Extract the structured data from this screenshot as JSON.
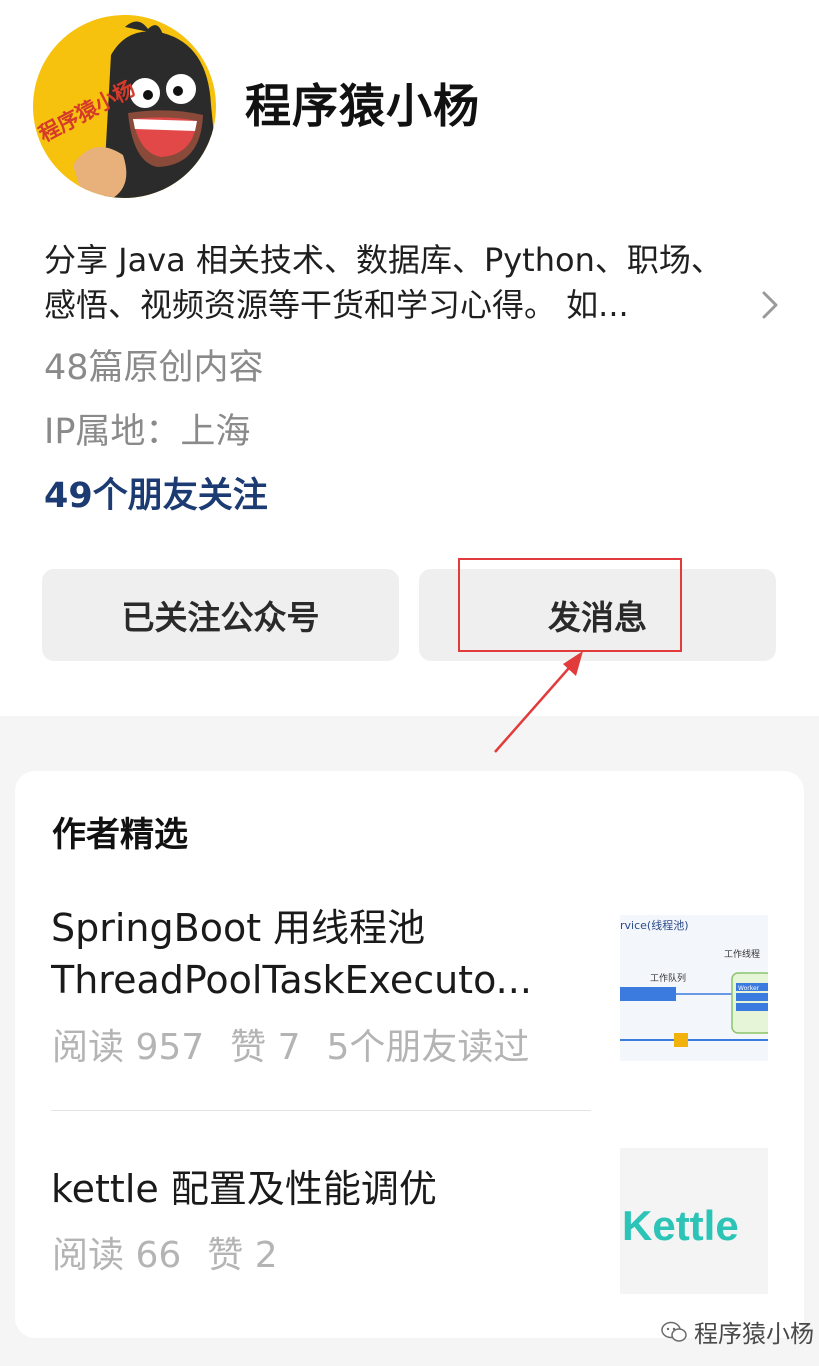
{
  "profile": {
    "name": "程序猿小杨",
    "avatar_text": "程序猿小杨",
    "description_lines": [
      "分享 Java 相关技术、数据库、Python、职场、",
      "感悟、视频资源等干货和学习心得。 如..."
    ],
    "articles_count": "48篇原创内容",
    "ip_location": "IP属地：上海",
    "friends_following": "49个朋友关注"
  },
  "actions": {
    "follow_label": "已关注公众号",
    "message_label": "发消息"
  },
  "featured": {
    "title": "作者精选",
    "articles": [
      {
        "title_lines": [
          "SpringBoot 用线程池",
          "ThreadPoolTaskExecuto..."
        ],
        "reads": "阅读 957",
        "likes": "赞 7",
        "friends_read": "5个朋友读过",
        "thumb_caption": "rvice(线程池)",
        "thumb_labels": [
          "工作线程",
          "工作队列",
          "Worker"
        ]
      },
      {
        "title_lines": [
          "kettle 配置及性能调优"
        ],
        "reads": "阅读 66",
        "likes": "赞 2",
        "thumb_logo": "Kettle"
      }
    ]
  },
  "watermark": "程序猿小杨",
  "colors": {
    "accent_link": "#1d3b73",
    "highlight_red": "#e23b3b",
    "avatar_yellow": "#f6c20e",
    "kettle_teal": "#2bc4b6"
  }
}
